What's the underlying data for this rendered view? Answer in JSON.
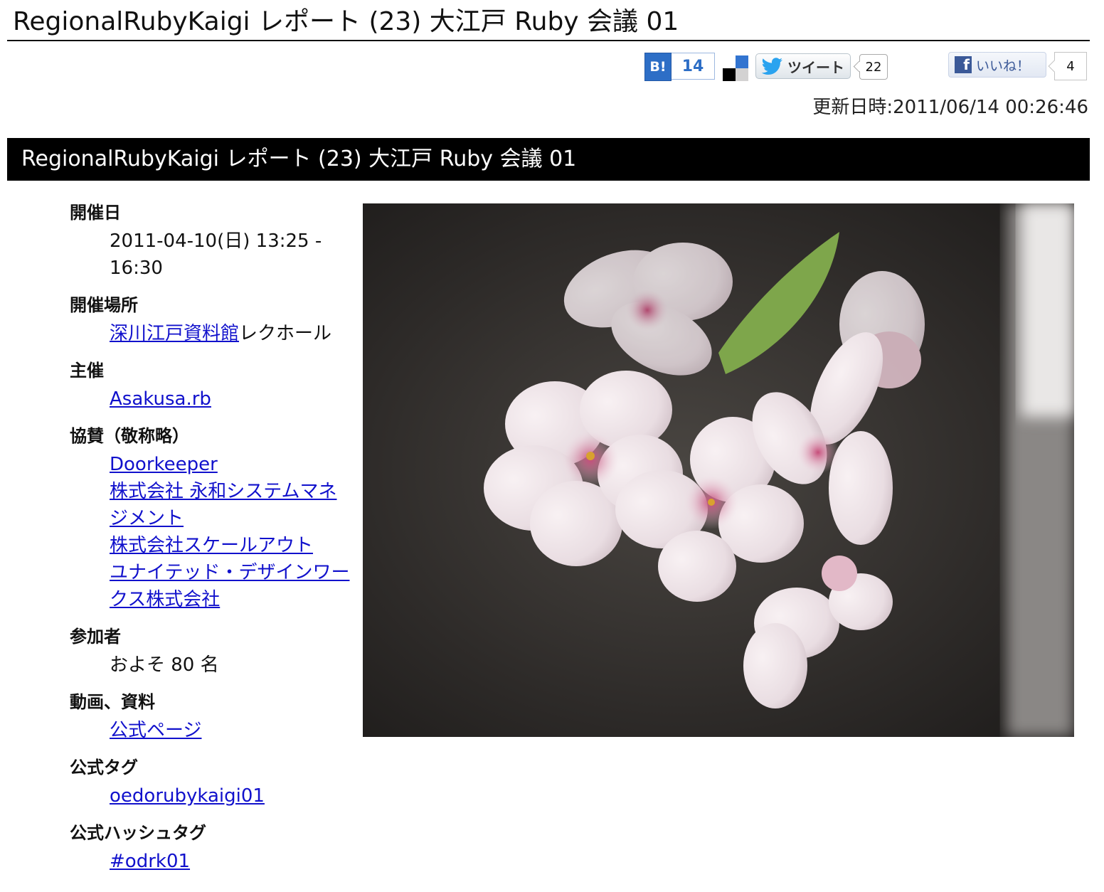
{
  "page": {
    "title": "RegionalRubyKaigi レポート (23) 大江戸 Ruby 会議 01",
    "updated": "更新日時:2011/06/14 00:26:46",
    "section_title": "RegionalRubyKaigi レポート (23) 大江戸 Ruby 会議 01"
  },
  "social": {
    "hatena_logo": "B!",
    "hatena_count": "14",
    "tweet_label": "ツイート",
    "tweet_count": "22",
    "like_label": "いいね！",
    "like_count": "4",
    "icons": [
      "hatena-bookmark-icon",
      "delicious-icon",
      "twitter-bird-icon",
      "facebook-icon"
    ]
  },
  "info": {
    "date_label": "開催日",
    "date_value": "2011-04-10(日) 13:25 - 16:30",
    "venue_label": "開催場所",
    "venue_link": "深川江戸資料館",
    "venue_rest": "レクホール",
    "host_label": "主催",
    "host_link": "Asakusa.rb",
    "sponsors_label": "協賛（敬称略）",
    "sponsors": [
      "Doorkeeper",
      "株式会社 永和システムマネジメント",
      "株式会社スケールアウト",
      "ユナイテッド・デザインワークス株式会社"
    ],
    "attendees_label": "参加者",
    "attendees_value": "およそ 80 名",
    "media_label": "動画、資料",
    "media_link": "公式ページ",
    "tag_label": "公式タグ",
    "tag_link": "oedorubykaigi01",
    "hashtag_label": "公式ハッシュタグ",
    "hashtag_link": "#odrk01"
  }
}
